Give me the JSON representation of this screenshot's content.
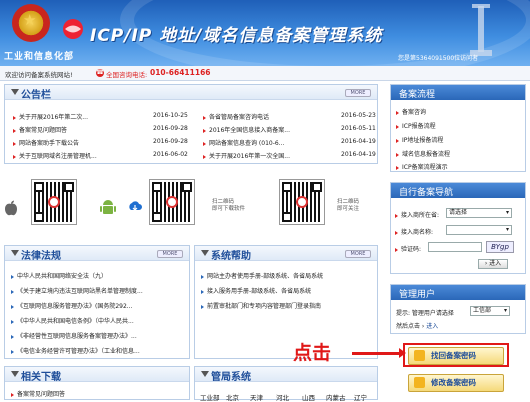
{
  "header": {
    "ministry": "工业和信息化部",
    "title": "ICP/IP 地址/域名信息备案管理系统",
    "server": "您是第5364091500位访问者"
  },
  "welcome_bar": {
    "text": "欢迎访问备案系统网站!",
    "phone_label": "全国咨询电话:",
    "phone_number": "010-66411166"
  },
  "announcements": {
    "title": "公告栏",
    "more": "MORE",
    "left": [
      {
        "text": "关于开展2016年第二次...",
        "date": "2016-10-25"
      },
      {
        "text": "备案常见问题回答",
        "date": "2016-09-28"
      },
      {
        "text": "网站备案助手下载公告",
        "date": "2016-09-28"
      },
      {
        "text": "关于互联网域名注册管理机...",
        "date": "2016-06-02"
      }
    ],
    "right": [
      {
        "text": "各省管局备案咨询电话",
        "date": "2016-05-23"
      },
      {
        "text": "2016年全国信息接入商备案...",
        "date": "2016-05-11"
      },
      {
        "text": "网站备案信息查询 (010-6...",
        "date": "2016-04-19"
      },
      {
        "text": "关于开展2016年第一次全国...",
        "date": "2016-04-19"
      }
    ]
  },
  "qr": {
    "download_label_1": "扫二维码",
    "download_label_2": "即可下载软件",
    "follow_label_1": "扫二维码",
    "follow_label_2": "即可关注"
  },
  "laws": {
    "title": "法律法规",
    "more": "MORE",
    "items": [
      "中华人民共和国网络安全法（九）",
      "《关于建立境内违法互联网站黑名单管理制度...",
      "《互联网信息服务管理办法》(国务院292...",
      "《中华人民共和国电信条例》（中华人民共...",
      "《非经营性互联网信息服务备案管理办法》...",
      "《电信业务经营许可管理办法》（工业和信息..."
    ]
  },
  "help": {
    "title": "系统帮助",
    "more": "MORE",
    "items": [
      "网站主办者使用手册-部级系统、各省局系统",
      "接入服务用手册-部级系统、各省局系统",
      "前置审批部门和专项内容管理部门登录指南"
    ]
  },
  "downloads": {
    "title": "相关下载",
    "items": [
      "备案常见问题回答"
    ]
  },
  "bureau": {
    "title": "管局系统",
    "cities": [
      "工业部",
      "北京",
      "天津",
      "河北",
      "山西",
      "内蒙古",
      "辽宁"
    ]
  },
  "flow": {
    "title": "备案流程",
    "items": [
      "备案咨询",
      "ICP报备流程",
      "IP地址报备流程",
      "域名信息报备流程",
      "ICP备案流程演示"
    ]
  },
  "self_nav": {
    "title": "自行备案导航",
    "isp_label": "接入商所在省:",
    "isp_value": "请选择",
    "isp_name_label": "接入商名称:",
    "captcha_label": "验证码:",
    "captcha_text": "BYgp",
    "enter_button": "进入"
  },
  "user_mgmt": {
    "title": "管理用户",
    "prompt": "提示: 管理用户请选择",
    "select_value": "工信部",
    "then_click": "然后点击",
    "enter_link": "进入"
  },
  "buttons": {
    "find_password": "找回备案密码",
    "change_password": "修改备案密码"
  },
  "annotation": {
    "text": "点击"
  }
}
